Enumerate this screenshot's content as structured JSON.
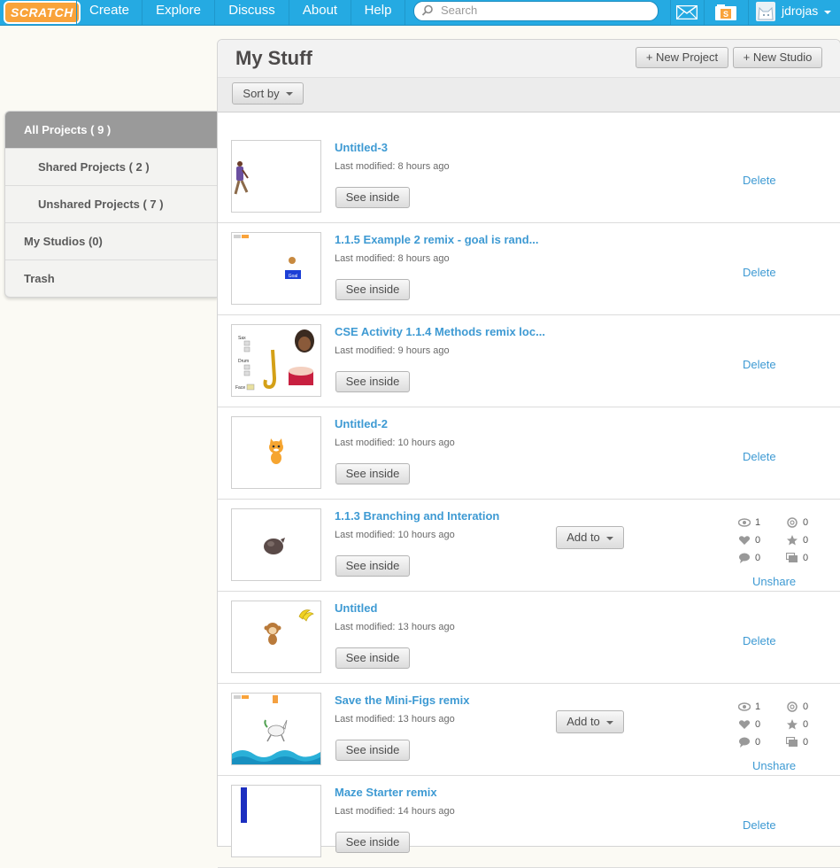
{
  "header": {
    "logo_text": "SCRATCH",
    "nav": [
      "Create",
      "Explore",
      "Discuss",
      "About",
      "Help"
    ],
    "search_placeholder": "Search",
    "username": "jdrojas",
    "colors": {
      "bar": "#25aae2",
      "logo": "#f9a33a"
    }
  },
  "page": {
    "title": "My Stuff",
    "new_project": "+ New Project",
    "new_studio": "+ New Studio",
    "sort_by": "Sort by"
  },
  "sidebar": {
    "items": [
      {
        "label": "All Projects ( 9 )"
      },
      {
        "label": "Shared Projects ( 2 )"
      },
      {
        "label": "Unshared Projects ( 7 )"
      },
      {
        "label": "My Studios (0)"
      },
      {
        "label": "Trash"
      }
    ]
  },
  "labels": {
    "see_inside": "See inside",
    "delete": "Delete",
    "unshare": "Unshare",
    "add_to": "Add to"
  },
  "projects": [
    {
      "title": "Untitled-3",
      "modified": "Last modified: 8 hours ago"
    },
    {
      "title": "1.1.5 Example 2 remix - goal is rand...",
      "modified": "Last modified: 8 hours ago",
      "thumb_text": "Goal"
    },
    {
      "title": "CSE Activity 1.1.4 Methods remix loc...",
      "modified": "Last modified: 9 hours ago",
      "thumb_text": [
        "Sax",
        "Drum",
        "Face"
      ]
    },
    {
      "title": "Untitled-2",
      "modified": "Last modified: 10 hours ago"
    },
    {
      "title": "1.1.3 Branching and Interation",
      "modified": "Last modified: 10 hours ago",
      "stats": {
        "views": "1",
        "remixes": "0",
        "loves": "0",
        "favorites": "0",
        "comments": "0",
        "studios": "0"
      }
    },
    {
      "title": "Untitled",
      "modified": "Last modified: 13 hours ago"
    },
    {
      "title": "Save the Mini-Figs remix",
      "modified": "Last modified: 13 hours ago",
      "stats": {
        "views": "1",
        "remixes": "0",
        "loves": "0",
        "favorites": "0",
        "comments": "0",
        "studios": "0"
      }
    },
    {
      "title": "Maze Starter remix",
      "modified": "Last modified: 14 hours ago"
    }
  ]
}
